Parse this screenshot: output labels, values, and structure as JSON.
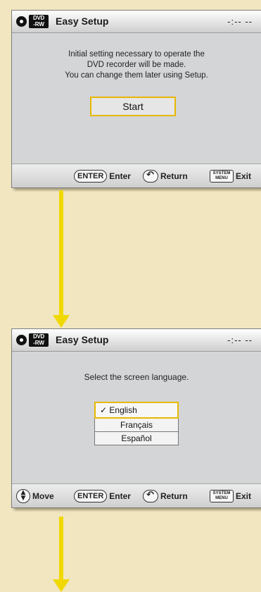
{
  "screens": [
    {
      "title": "Easy Setup",
      "clock": "-:-- --",
      "message_lines": [
        "Initial setting necessary to operate the",
        "DVD recorder will be made.",
        "You can change them later using Setup."
      ],
      "start_label": "Start",
      "footer": {
        "enter_key": "ENTER",
        "enter_label": "Enter",
        "return_label": "Return",
        "system_key_line1": "SYSTEM",
        "system_key_line2": "MENU",
        "exit_label": "Exit"
      }
    },
    {
      "title": "Easy Setup",
      "clock": "-:-- --",
      "prompt": "Select the screen language.",
      "languages": [
        {
          "label": "English",
          "selected": true
        },
        {
          "label": "Français",
          "selected": false
        },
        {
          "label": "Español",
          "selected": false
        }
      ],
      "check_mark": "✓",
      "footer": {
        "move_label": "Move",
        "enter_key": "ENTER",
        "enter_label": "Enter",
        "return_label": "Return",
        "system_key_line1": "SYSTEM",
        "system_key_line2": "MENU",
        "exit_label": "Exit"
      }
    }
  ],
  "badge": {
    "line1": "DVD",
    "line2": "-RW"
  },
  "icons": [
    "disc-icon",
    "return-icon",
    "move-icon",
    "down-arrow"
  ],
  "colors": {
    "background": "#f1e6c0",
    "panel": "#d4d5d7",
    "highlight": "#e6b800",
    "arrow": "#f0d800"
  }
}
